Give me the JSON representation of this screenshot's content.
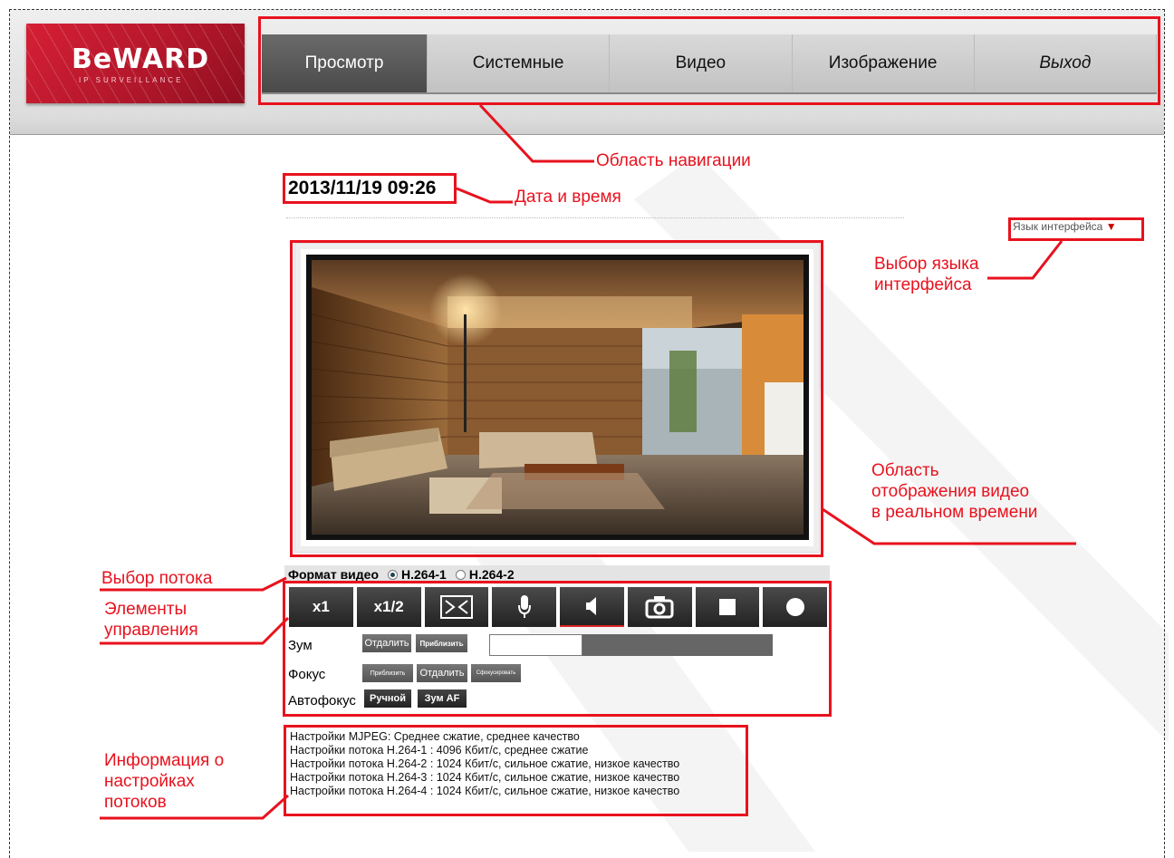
{
  "app": {
    "logo_text": "BeWARD",
    "logo_subtitle": "IP SURVEILLANCE"
  },
  "nav": {
    "items": [
      {
        "label": "Просмотр",
        "active": true
      },
      {
        "label": "Системные"
      },
      {
        "label": "Видео"
      },
      {
        "label": "Изображение"
      },
      {
        "label": "Выход"
      }
    ]
  },
  "datetime": "2013/11/19 09:26",
  "language_selector": {
    "label": "Язык интерфейса",
    "arrow": "▼"
  },
  "stream": {
    "label": "Формат видео",
    "options": [
      "H.264-1",
      "H.264-2"
    ],
    "selected": "H.264-1"
  },
  "toolbar": {
    "buttons": [
      {
        "label": "x1"
      },
      {
        "label": "x1/2"
      },
      {
        "icon": "fullscreen-icon"
      },
      {
        "icon": "microphone-icon"
      },
      {
        "icon": "speaker-icon",
        "selected": true
      },
      {
        "icon": "camera-icon"
      },
      {
        "icon": "stop-icon"
      },
      {
        "icon": "record-icon"
      }
    ]
  },
  "controls": {
    "zoom": {
      "label": "Зум",
      "out": "Отдалить",
      "in": "Приблизить",
      "level": 0.33
    },
    "focus": {
      "label": "Фокус",
      "near": "Приблизить",
      "far": "Отдалить",
      "auto": "Сфокусировать"
    },
    "autofocus": {
      "label": "Автофокус",
      "manual": "Ручной",
      "zoom_af": "Зум AF"
    }
  },
  "stream_info": [
    "Настройки MJPEG: Среднее сжатие, среднее качество",
    "Настройки потока H.264-1 : 4096 Кбит/с, среднее сжатие",
    "Настройки потока H.264-2 : 1024 Кбит/с, сильное сжатие, низкое качество",
    "Настройки потока H.264-3 : 1024 Кбит/с, сильное сжатие, низкое качество",
    "Настройки потока H.264-4 : 1024 Кбит/с, сильное сжатие, низкое качество"
  ],
  "annotations": {
    "navigation": "Область навигации",
    "datetime": "Дата и время",
    "language": [
      "Выбор языка",
      "интерфейса"
    ],
    "video": [
      "Область",
      "отображения видео",
      "в реальном времени"
    ],
    "stream_select": "Выбор потока",
    "controls": [
      "Элементы",
      "управления"
    ],
    "info": [
      "Информация о",
      "настройках",
      "потоков"
    ]
  },
  "colors": {
    "accent": "#e8121e",
    "brand": "#c8192e",
    "nav_active": "#555555"
  }
}
